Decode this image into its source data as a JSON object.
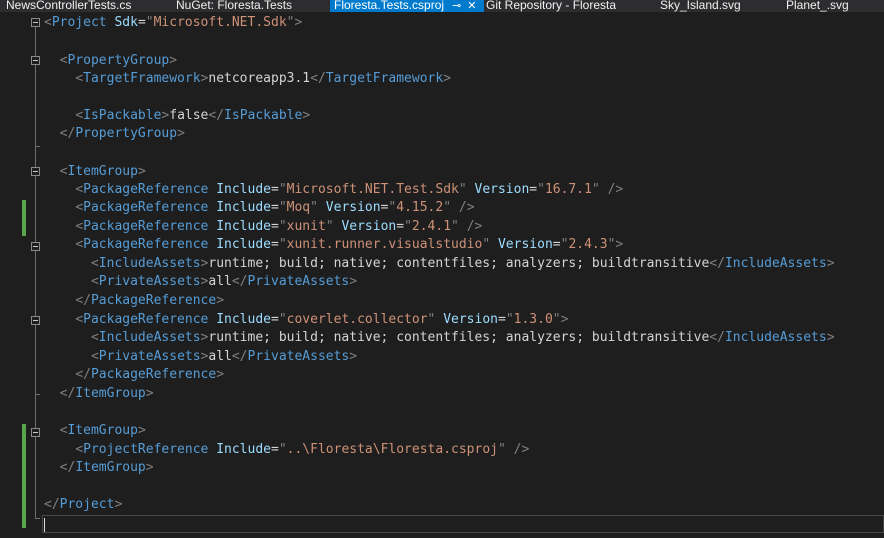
{
  "tabs": [
    {
      "label": "NewsControllerTests.cs",
      "active": false
    },
    {
      "label": "NuGet: Floresta.Tests",
      "active": false
    },
    {
      "label": "Floresta.Tests.csproj",
      "active": true,
      "pin": "⊸",
      "close": "✕"
    },
    {
      "label": "Git Repository - Floresta",
      "active": false
    },
    {
      "label": "Sky_Island.svg",
      "active": false
    },
    {
      "label": "Planet_.svg",
      "active": false
    }
  ],
  "code": {
    "project_tag": "Project",
    "sdk_attr": "Sdk",
    "sdk_value": "Microsoft.NET.Sdk",
    "property_group_tag": "PropertyGroup",
    "target_framework_tag": "TargetFramework",
    "target_framework_value": "netcoreapp3.1",
    "is_packable_tag": "IsPackable",
    "is_packable_value": "false",
    "item_group_tag": "ItemGroup",
    "package_reference_tag": "PackageReference",
    "include_attr": "Include",
    "version_attr": "Version",
    "include_assets_tag": "IncludeAssets",
    "private_assets_tag": "PrivateAssets",
    "include_assets_value": "runtime; build; native; contentfiles; analyzers; buildtransitive",
    "private_assets_value": "all",
    "project_reference_tag": "ProjectReference",
    "packages": [
      {
        "include": "Microsoft.NET.Test.Sdk",
        "version": "16.7.1"
      },
      {
        "include": "Moq",
        "version": "4.15.2"
      },
      {
        "include": "xunit",
        "version": "2.4.1"
      },
      {
        "include": "xunit.runner.visualstudio",
        "version": "2.4.3"
      },
      {
        "include": "coverlet.collector",
        "version": "1.3.0"
      }
    ],
    "project_reference_include": "..\\Floresta\\Floresta.csproj"
  },
  "colors": {
    "tag": "#569cd6",
    "attribute": "#9cdcfe",
    "value": "#ce9178",
    "text": "#d4d4d4",
    "active_tab": "#007acc",
    "change_bar": "#57a64a"
  }
}
